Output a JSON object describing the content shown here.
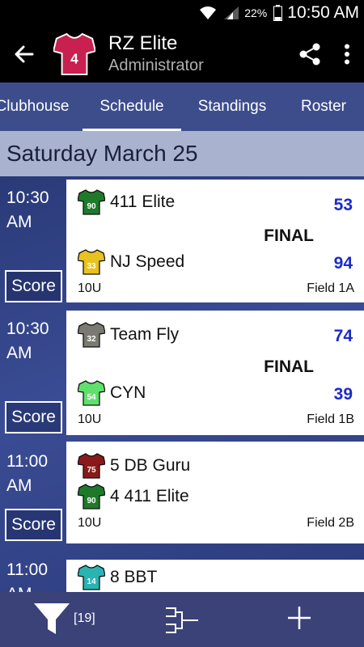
{
  "status_bar": {
    "battery_pct": "22%",
    "time": "10:50 AM"
  },
  "app_bar": {
    "team_number": "4",
    "title": "RZ Elite",
    "subtitle": "Administrator"
  },
  "tabs": [
    {
      "label": "Clubhouse",
      "active": false
    },
    {
      "label": "Schedule",
      "active": true
    },
    {
      "label": "Standings",
      "active": false
    },
    {
      "label": "Roster",
      "active": false
    }
  ],
  "date_header": "Saturday March 25",
  "score_label": "Score",
  "games": [
    {
      "time_hour": "10:30",
      "time_ampm": "AM",
      "status": "FINAL",
      "team1": {
        "name": "411 Elite",
        "number": "90",
        "score": "53",
        "color": "#1e7a2a"
      },
      "team2": {
        "name": "NJ Speed",
        "number": "33",
        "score": "94",
        "color": "#e8c21e"
      },
      "division": "10U",
      "field": "Field 1A"
    },
    {
      "time_hour": "10:30",
      "time_ampm": "AM",
      "status": "FINAL",
      "team1": {
        "name": "Team Fly",
        "number": "32",
        "score": "74",
        "color": "#7a7a72"
      },
      "team2": {
        "name": "CYN",
        "number": "54",
        "score": "39",
        "color": "#5fe06a"
      },
      "division": "10U",
      "field": "Field 1B"
    },
    {
      "time_hour": "11:00",
      "time_ampm": "AM",
      "status": "",
      "team1": {
        "name": "5 DB Guru",
        "number": "75",
        "score": "",
        "color": "#8a1a1a"
      },
      "team2": {
        "name": "4 411 Elite",
        "number": "90",
        "score": "",
        "color": "#1e7a2a"
      },
      "division": "10U",
      "field": "Field 2B"
    },
    {
      "time_hour": "11:00",
      "time_ampm": "AM",
      "status": "",
      "team1": {
        "name": "8 BBT",
        "number": "14",
        "score": "",
        "color": "#2ab3b3"
      },
      "team2": {
        "name": "",
        "number": "",
        "score": "",
        "color": "#2ab3b3"
      },
      "division": "",
      "field": ""
    }
  ],
  "bottom_bar": {
    "filter_count": "[19]"
  },
  "colors": {
    "app_bar": "#000000",
    "tab_bar": "#3d4d8c",
    "date_header": "#a9b3cf",
    "score_text": "#1a2acc",
    "bottom_bar": "#3a4278",
    "team_jersey": "#c8204f"
  }
}
